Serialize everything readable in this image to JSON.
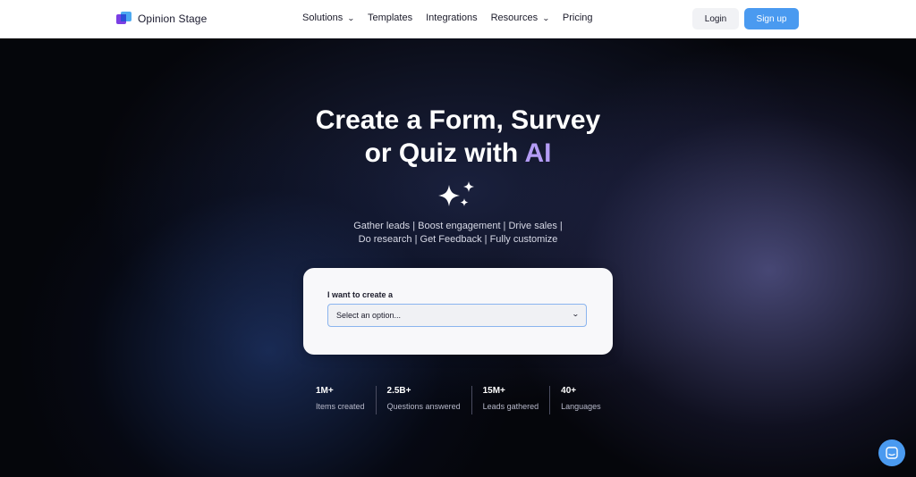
{
  "brand": {
    "name": "Opinion Stage"
  },
  "nav": {
    "items": [
      {
        "label": "Solutions",
        "has_dropdown": true
      },
      {
        "label": "Templates",
        "has_dropdown": false
      },
      {
        "label": "Integrations",
        "has_dropdown": false
      },
      {
        "label": "Resources",
        "has_dropdown": true
      },
      {
        "label": "Pricing",
        "has_dropdown": false
      }
    ],
    "login_label": "Login",
    "signup_label": "Sign up"
  },
  "hero": {
    "headline_line1": "Create a Form, Survey",
    "headline_line2_prefix": "or Quiz with ",
    "headline_highlight": "AI",
    "tagline_line1": "Gather leads | Boost engagement | Drive sales |",
    "tagline_line2": "Do research | Get Feedback | Fully customize"
  },
  "form": {
    "label": "I want to create a",
    "select_value": "Select an option..."
  },
  "stats": [
    {
      "value": "1M+",
      "label": "Items created"
    },
    {
      "value": "2.5B+",
      "label": "Questions answered"
    },
    {
      "value": "15M+",
      "label": "Leads gathered"
    },
    {
      "value": "40+",
      "label": "Languages"
    }
  ],
  "icons": {
    "logo": "opinion-stage-logo-icon",
    "sparkles": "sparkles-icon",
    "chevron": "chevron-down-icon",
    "chat": "chat-icon"
  },
  "colors": {
    "accent": "#4a9af0",
    "ai_highlight": "#b49cf5",
    "hero_bg": "#05060b"
  }
}
